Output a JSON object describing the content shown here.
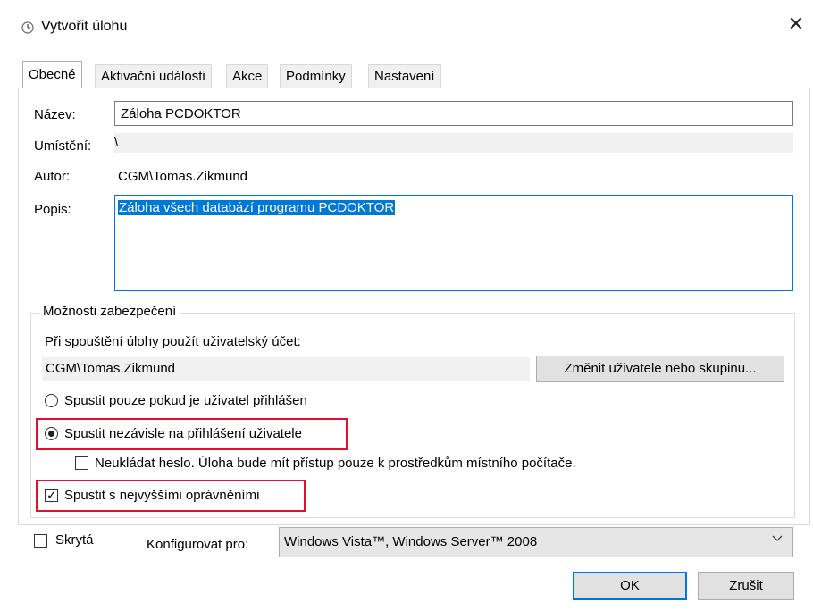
{
  "window": {
    "title": "Vytvořit úlohu",
    "close_glyph": "✕"
  },
  "tabs": [
    {
      "label": "Obecné",
      "active": true
    },
    {
      "label": "Aktivační události",
      "active": false
    },
    {
      "label": "Akce",
      "active": false
    },
    {
      "label": "Podmínky",
      "active": false
    },
    {
      "label": "Nastavení",
      "active": false
    }
  ],
  "general": {
    "name_label": "Název:",
    "name_value": "Záloha PCDOKTOR",
    "location_label": "Umístění:",
    "location_value": "\\",
    "author_label": "Autor:",
    "author_value": "CGM\\Tomas.Zikmund",
    "description_label": "Popis:",
    "description_value": "Záloha všech databází programu PCDOKTOR"
  },
  "security": {
    "legend": "Možnosti zabezpečení",
    "account_prompt": "Při spouštění úlohy použít uživatelský účet:",
    "account_value": "CGM\\Tomas.Zikmund",
    "change_user_button": "Změnit uživatele nebo skupinu...",
    "radio_logged_on": "Spustit pouze pokud je uživatel přihlášen",
    "radio_independent": "Spustit nezávisle na přihlášení uživatele",
    "selected_radio": "independent",
    "no_store_password": "Neukládat heslo.  Úloha bude mít přístup pouze k prostředkům místního počítače.",
    "no_store_password_checked": false,
    "highest_privileges": "Spustit s nejvyššími oprávněními",
    "highest_privileges_checked": true,
    "highlight_color": "#e0102e"
  },
  "footer": {
    "hidden_label": "Skrytá",
    "hidden_checked": false,
    "configure_label": "Konfigurovat pro:",
    "configure_value": "Windows Vista™, Windows Server™ 2008",
    "ok_button": "OK",
    "cancel_button": "Zrušit"
  },
  "colors": {
    "selection": "#0078d7",
    "button_face": "#e1e1e1",
    "readonly_bg": "#f0f0f0"
  }
}
